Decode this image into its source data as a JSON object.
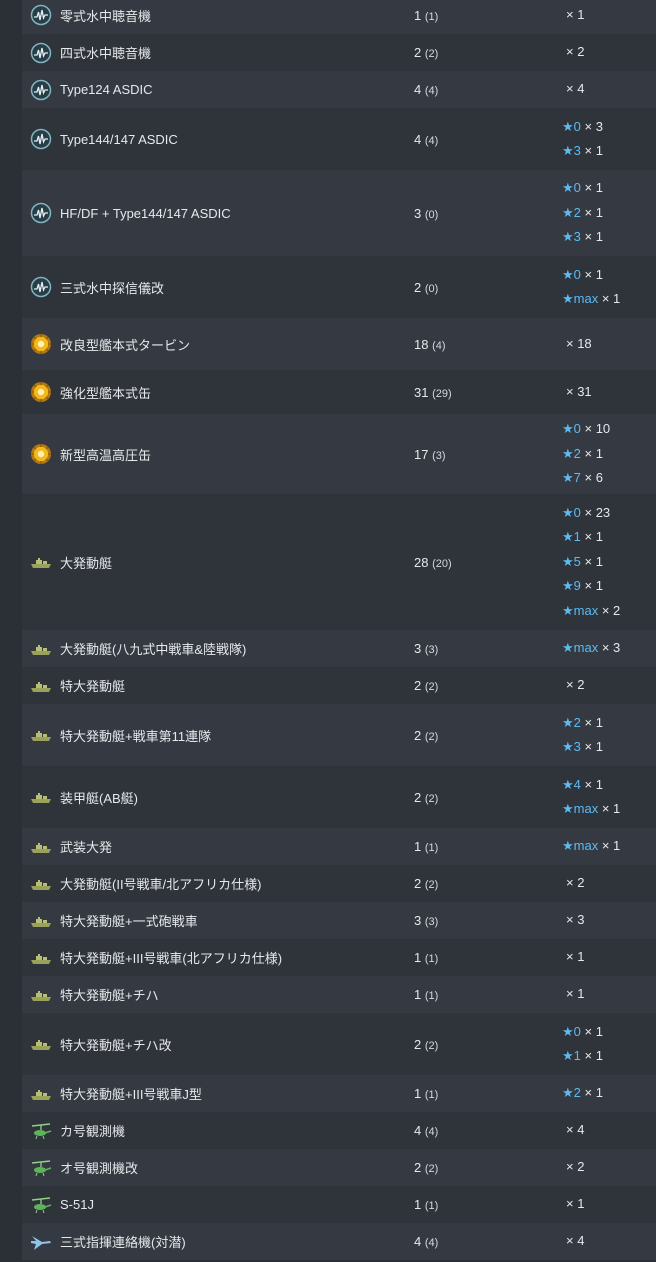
{
  "rows": [
    {
      "name": "零式水中聴音機",
      "icon": "sonar-icon",
      "count": "1",
      "paren": "(1)",
      "h": 38,
      "stars": [
        {
          "lvl": "",
          "mul": "× 1"
        }
      ]
    },
    {
      "name": "四式水中聴音機",
      "icon": "sonar-icon",
      "count": "2",
      "paren": "(2)",
      "h": 37,
      "stars": [
        {
          "lvl": "",
          "mul": "× 2"
        }
      ]
    },
    {
      "name": "Type124 ASDIC",
      "icon": "sonar-icon",
      "count": "4",
      "paren": "(4)",
      "h": 37,
      "stars": [
        {
          "lvl": "",
          "mul": "× 4"
        }
      ]
    },
    {
      "name": "Type144/147 ASDIC",
      "icon": "sonar-icon",
      "count": "4",
      "paren": "(4)",
      "h": 62,
      "stars": [
        {
          "lvl": "★0",
          "mul": " × 3"
        },
        {
          "lvl": "★3",
          "mul": " × 1"
        }
      ]
    },
    {
      "name": "HF/DF + Type144/147 ASDIC",
      "icon": "sonar-icon",
      "count": "3",
      "paren": "(0)",
      "h": 86,
      "stars": [
        {
          "lvl": "★0",
          "mul": " × 1"
        },
        {
          "lvl": "★2",
          "mul": " × 1"
        },
        {
          "lvl": "★3",
          "mul": " × 1"
        }
      ]
    },
    {
      "name": "三式水中探信儀改",
      "icon": "sonar-icon",
      "count": "2",
      "paren": "(0)",
      "h": 62,
      "stars": [
        {
          "lvl": "★0",
          "mul": " × 1"
        },
        {
          "lvl": "★max",
          "mul": " × 1"
        }
      ]
    },
    {
      "name": "改良型艦本式タービン",
      "icon": "turbine-icon",
      "count": "18",
      "paren": "(4)",
      "h": 52,
      "stars": [
        {
          "lvl": "",
          "mul": "× 18"
        }
      ]
    },
    {
      "name": "強化型艦本式缶",
      "icon": "turbine-icon",
      "count": "31",
      "paren": "(29)",
      "h": 44,
      "stars": [
        {
          "lvl": "",
          "mul": "× 31"
        }
      ]
    },
    {
      "name": "新型高温高圧缶",
      "icon": "turbine-icon",
      "count": "17",
      "paren": "(3)",
      "h": 80,
      "stars": [
        {
          "lvl": "★0",
          "mul": " × 10"
        },
        {
          "lvl": "★2",
          "mul": " × 1"
        },
        {
          "lvl": "★7",
          "mul": " × 6"
        }
      ]
    },
    {
      "name": "大発動艇",
      "icon": "landing-craft-icon",
      "count": "28",
      "paren": "(20)",
      "h": 136,
      "stars": [
        {
          "lvl": "★0",
          "mul": " × 23"
        },
        {
          "lvl": "★1",
          "mul": " × 1"
        },
        {
          "lvl": "★5",
          "mul": " × 1"
        },
        {
          "lvl": "★9",
          "mul": " × 1"
        },
        {
          "lvl": "★max",
          "mul": " × 2"
        }
      ]
    },
    {
      "name": "大発動艇(八九式中戦車&陸戦隊)",
      "icon": "landing-craft-icon",
      "count": "3",
      "paren": "(3)",
      "h": 37,
      "stars": [
        {
          "lvl": "★max",
          "mul": " × 3"
        }
      ]
    },
    {
      "name": "特大発動艇",
      "icon": "landing-craft-icon",
      "count": "2",
      "paren": "(2)",
      "h": 37,
      "stars": [
        {
          "lvl": "",
          "mul": "× 2"
        }
      ]
    },
    {
      "name": "特大発動艇+戦車第11連隊",
      "icon": "landing-craft-icon",
      "count": "2",
      "paren": "(2)",
      "h": 62,
      "stars": [
        {
          "lvl": "★2",
          "mul": " × 1"
        },
        {
          "lvl": "★3",
          "mul": " × 1"
        }
      ]
    },
    {
      "name": "装甲艇(AB艇)",
      "icon": "landing-craft-icon",
      "count": "2",
      "paren": "(2)",
      "h": 62,
      "stars": [
        {
          "lvl": "★4",
          "mul": " × 1"
        },
        {
          "lvl": "★max",
          "mul": " × 1"
        }
      ]
    },
    {
      "name": "武装大発",
      "icon": "landing-craft-icon",
      "count": "1",
      "paren": "(1)",
      "h": 37,
      "stars": [
        {
          "lvl": "★max",
          "mul": " × 1"
        }
      ]
    },
    {
      "name": "大発動艇(II号戦車/北アフリカ仕様)",
      "icon": "landing-craft-icon",
      "count": "2",
      "paren": "(2)",
      "h": 37,
      "stars": [
        {
          "lvl": "",
          "mul": "× 2"
        }
      ]
    },
    {
      "name": "特大発動艇+一式砲戦車",
      "icon": "landing-craft-icon",
      "count": "3",
      "paren": "(3)",
      "h": 37,
      "stars": [
        {
          "lvl": "",
          "mul": "× 3"
        }
      ]
    },
    {
      "name": "特大発動艇+III号戦車(北アフリカ仕様)",
      "icon": "landing-craft-icon",
      "count": "1",
      "paren": "(1)",
      "h": 37,
      "stars": [
        {
          "lvl": "",
          "mul": "× 1"
        }
      ]
    },
    {
      "name": "特大発動艇+チハ",
      "icon": "landing-craft-icon",
      "count": "1",
      "paren": "(1)",
      "h": 37,
      "stars": [
        {
          "lvl": "",
          "mul": "× 1"
        }
      ]
    },
    {
      "name": "特大発動艇+チハ改",
      "icon": "landing-craft-icon",
      "count": "2",
      "paren": "(2)",
      "h": 62,
      "stars": [
        {
          "lvl": "★0",
          "mul": " × 1"
        },
        {
          "lvl": "★1",
          "mul": " × 1"
        }
      ]
    },
    {
      "name": "特大発動艇+III号戦車J型",
      "icon": "landing-craft-icon",
      "count": "1",
      "paren": "(1)",
      "h": 37,
      "stars": [
        {
          "lvl": "★2",
          "mul": " × 1"
        }
      ]
    },
    {
      "name": "カ号観測機",
      "icon": "autogyro-icon",
      "count": "4",
      "paren": "(4)",
      "h": 37,
      "stars": [
        {
          "lvl": "",
          "mul": "× 4"
        }
      ]
    },
    {
      "name": "オ号観測機改",
      "icon": "autogyro-icon",
      "count": "2",
      "paren": "(2)",
      "h": 37,
      "stars": [
        {
          "lvl": "",
          "mul": "× 2"
        }
      ]
    },
    {
      "name": "S-51J",
      "icon": "autogyro-icon",
      "count": "1",
      "paren": "(1)",
      "h": 37,
      "stars": [
        {
          "lvl": "",
          "mul": "× 1"
        }
      ]
    },
    {
      "name": "三式指揮連絡機(対潜)",
      "icon": "liaison-plane-icon",
      "count": "4",
      "paren": "(4)",
      "h": 37,
      "stars": [
        {
          "lvl": "",
          "mul": "× 4"
        }
      ]
    }
  ]
}
